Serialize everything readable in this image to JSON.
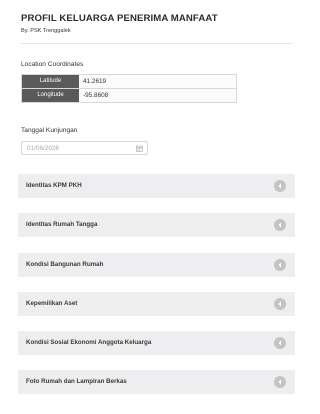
{
  "header": {
    "title": "PROFIL KELUARGA PENERIMA MANFAAT",
    "subtitle": "By. PSK Trenggalek"
  },
  "location": {
    "label": "Location Coordinates",
    "rows": [
      {
        "key": "Latitude",
        "value": "41.2619"
      },
      {
        "key": "Longitude",
        "value": "-95.8608"
      }
    ]
  },
  "visit": {
    "label": "Tanggal Kunjungan",
    "date_value": "01/06/2026",
    "icon": "calendar-icon"
  },
  "sections": [
    {
      "label": "Identitas KPM PKH"
    },
    {
      "label": "Identitas Rumah Tangga"
    },
    {
      "label": "Kondisi Bangunan Rumah"
    },
    {
      "label": "Kepemilikan Aset"
    },
    {
      "label": "Kondisi Sosial Ekonomi Anggota Keluarga"
    },
    {
      "label": "Foto Rumah dan Lampiran Berkas"
    }
  ],
  "colors": {
    "section_bg": "#eeeef0",
    "coord_key_bg": "#5a5a5a",
    "chevron_circle": "#c4c4c4"
  }
}
